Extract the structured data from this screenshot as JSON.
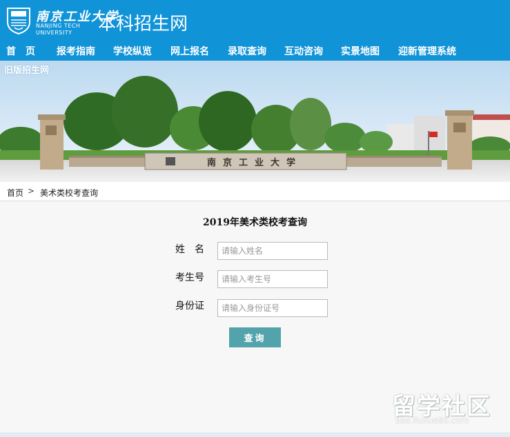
{
  "header": {
    "logo_cn": "南京工业大学",
    "logo_en_line1": "NANJING TECH",
    "logo_en_line2": "UNIVERSITY",
    "site_title": "本科招生网"
  },
  "nav": {
    "items": [
      {
        "label": "首　页"
      },
      {
        "label": "报考指南"
      },
      {
        "label": "学校纵览"
      },
      {
        "label": "网上报名"
      },
      {
        "label": "录取查询"
      },
      {
        "label": "互动咨询"
      },
      {
        "label": "实景地图"
      },
      {
        "label": "迎新管理系统"
      }
    ]
  },
  "banner": {
    "old_site_link": "旧版招生网",
    "gate_text": "南京工业大学"
  },
  "breadcrumb": {
    "home": "首页",
    "separator": ">",
    "current": "美术类校考查询"
  },
  "form": {
    "title": "2019年美术类校考查询",
    "name_label": "姓　名",
    "name_placeholder": "请输入姓名",
    "exam_label": "考生号",
    "exam_placeholder": "请输入考生号",
    "id_label": "身份证",
    "id_placeholder": "请输入身份证号",
    "submit_label": "查询"
  },
  "watermark": {
    "big": "留学社区",
    "small": "bbs.liuxue86.com"
  },
  "colors": {
    "header_bg": "#1193d8",
    "button_bg": "#52a3ac",
    "page_bg": "#f7f7f7"
  }
}
